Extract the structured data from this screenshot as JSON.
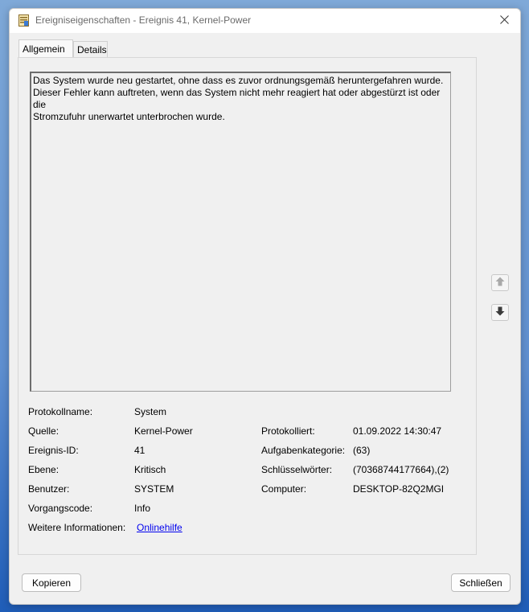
{
  "window": {
    "title": "Ereigniseigenschaften - Ereignis 41, Kernel-Power"
  },
  "tabs": [
    {
      "label": "Allgemein",
      "selected": true
    },
    {
      "label": "Details",
      "selected": false
    }
  ],
  "description": "Das System wurde neu gestartet, ohne dass es zuvor ordnungsgemäß heruntergefahren wurde.\nDieser Fehler kann auftreten, wenn das System nicht mehr reagiert hat oder abgestürzt ist oder die\nStromzufuhr unerwartet unterbrochen wurde.",
  "properties": {
    "protokollname": {
      "label": "Protokollname:",
      "value": "System"
    },
    "quelle": {
      "label": "Quelle:",
      "value": "Kernel-Power"
    },
    "protokolliert": {
      "label": "Protokolliert:",
      "value": "01.09.2022 14:30:47"
    },
    "ereignis_id": {
      "label": "Ereignis-ID:",
      "value": "41"
    },
    "aufgabenkategorie": {
      "label": "Aufgabenkategorie:",
      "value": "(63)"
    },
    "ebene": {
      "label": "Ebene:",
      "value": "Kritisch"
    },
    "schluesselwoerter": {
      "label": "Schlüsselwörter:",
      "value": "(70368744177664),(2)"
    },
    "benutzer": {
      "label": "Benutzer:",
      "value": "SYSTEM"
    },
    "computer": {
      "label": "Computer:",
      "value": "DESKTOP-82Q2MGI"
    },
    "vorgangscode": {
      "label": "Vorgangscode:",
      "value": "Info"
    },
    "weitere_informationen": {
      "label": "Weitere Informationen:",
      "link": "Onlinehilfe"
    }
  },
  "buttons": {
    "copy": "Kopieren",
    "close": "Schließen"
  },
  "icons": {
    "app": "event-properties-icon",
    "close": "close-icon",
    "previous": "arrow-up-icon",
    "next": "arrow-down-icon"
  }
}
